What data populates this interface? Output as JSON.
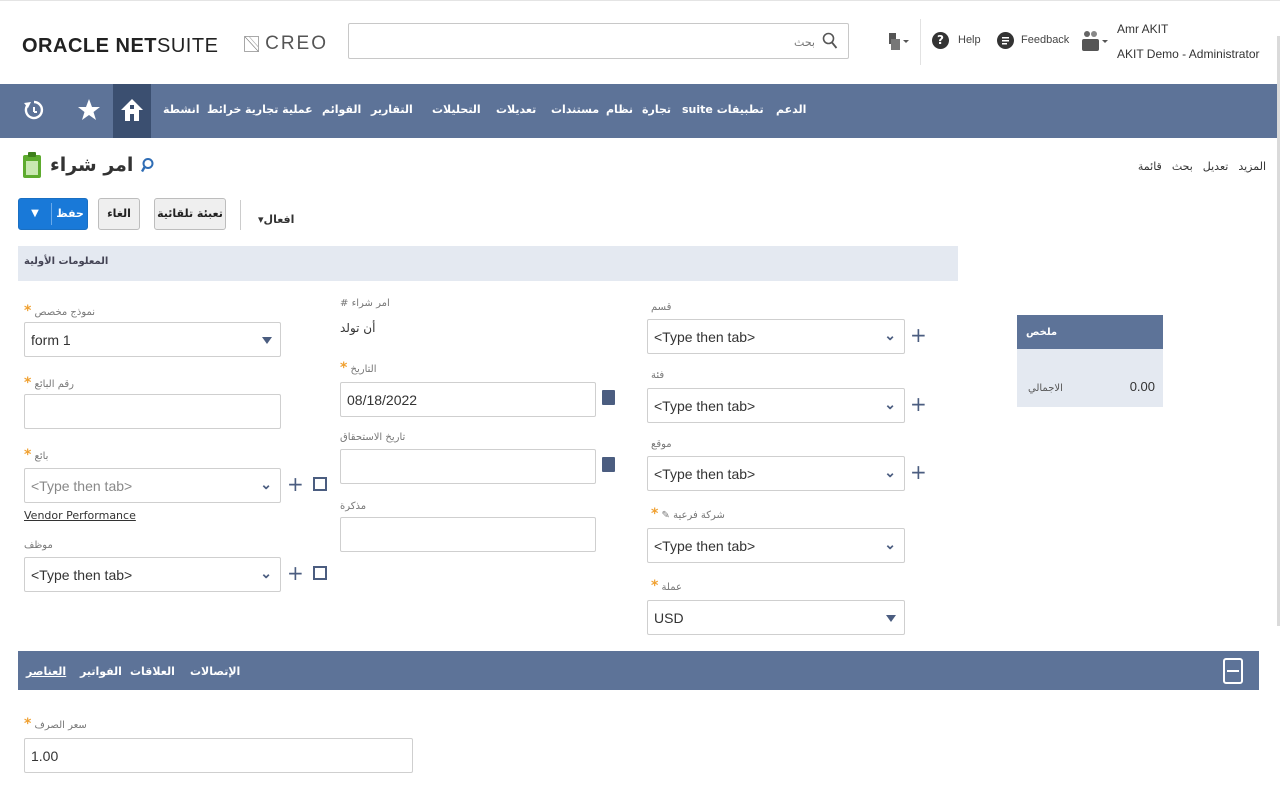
{
  "header": {
    "logo_oracle": "ORACLE",
    "logo_net": "NET",
    "logo_suite": "SUITE",
    "creo_text": "CREO",
    "search_placeholder": "بحث",
    "help_label": "Help",
    "feedback_label": "Feedback",
    "user_name": "Amr AKIT",
    "user_role": "AKIT Demo - Administrator"
  },
  "nav": {
    "items": [
      "الدعم",
      "suite تطبيقات",
      "تجارة",
      "نظام",
      "مستندات",
      "تعديلات",
      "التحليلات",
      "التقارير",
      "القوائم",
      "عملية تجارية",
      "خرائط",
      "انشطة"
    ]
  },
  "page": {
    "title": "امر شراء",
    "links": [
      "المزيد",
      "تعديل",
      "بحث",
      "قائمة"
    ]
  },
  "toolbar": {
    "save_label": "حفظ",
    "cancel_label": "الغاء",
    "autofill_label": "تعبئة تلقائية",
    "actions_label": "افعال"
  },
  "primary_section": {
    "title": "المعلومات الأولية"
  },
  "form": {
    "custom_form_label": "نموذج مخصص",
    "custom_form_value": "form 1",
    "vendor_number_label": "رقم البائع",
    "vendor_number_value": "",
    "vendor_label": "بائع",
    "vendor_placeholder": "<Type then tab>",
    "vendor_performance_link": "Vendor Performance",
    "employee_label": "موظف",
    "employee_placeholder": "<Type then tab>",
    "po_number_label": "# امر شراء",
    "po_number_value": "أن تولد",
    "date_label": "التاريخ",
    "date_value": "08/18/2022",
    "due_date_label": "تاريخ الاستحقاق",
    "due_date_value": "",
    "memo_label": "مذكرة",
    "memo_value": "",
    "department_label": "قسم",
    "department_placeholder": "<Type then tab>",
    "class_label": "فئة",
    "class_placeholder": "<Type then tab>",
    "location_label": "موقع",
    "location_placeholder": "<Type then tab>",
    "subsidiary_label": "شركة فرعية",
    "subsidiary_placeholder": "<Type then tab>",
    "currency_label": "عملة",
    "currency_value": "USD"
  },
  "summary": {
    "title": "ملخص",
    "total_label": "الاجمالي",
    "total_value": "0.00"
  },
  "tabs": {
    "items": [
      "العناصر",
      "الفواتير",
      "العلاقات",
      "الإتصالات"
    ]
  },
  "exchange": {
    "label": "سعر الصرف",
    "value": "1.00"
  },
  "colors": {
    "nav_bg": "#5d7398",
    "save_button": "#1979d8",
    "required_star": "#f0a030",
    "section_bg": "#e4e9f1"
  }
}
